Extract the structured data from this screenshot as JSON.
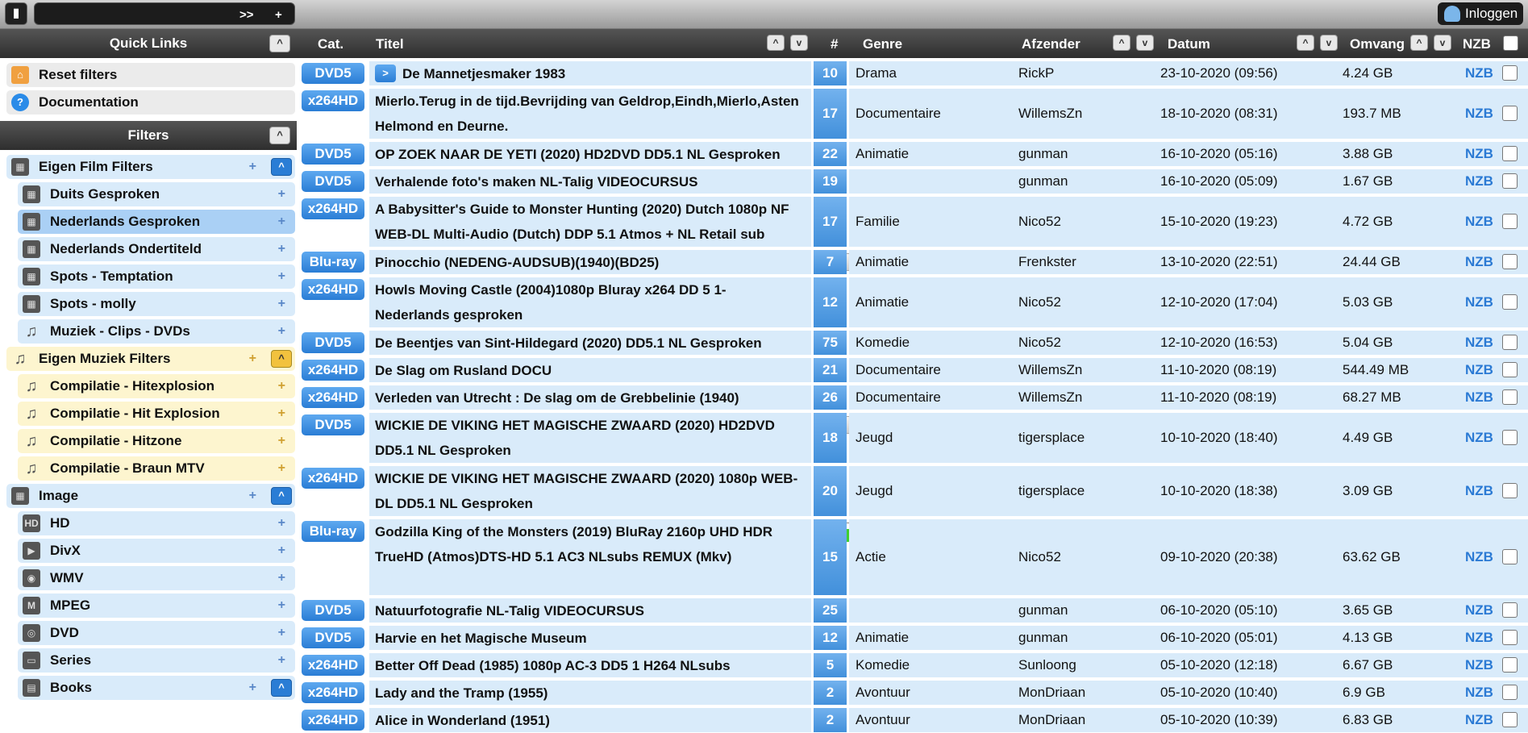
{
  "top": {
    "search_arrows": ">>",
    "search_plus": "+",
    "login": "Inloggen"
  },
  "left": {
    "quicklinks_title": "Quick Links",
    "quicklinks": [
      "Reset filters",
      "Documentation"
    ],
    "filters_title": "Filters",
    "items": [
      {
        "label": "Eigen Film Filters",
        "level": 0,
        "theme": "blue",
        "toggle": true
      },
      {
        "label": "Duits Gesproken",
        "level": 1,
        "theme": "blue"
      },
      {
        "label": "Nederlands Gesproken",
        "level": 1,
        "theme": "selected"
      },
      {
        "label": "Nederlands Ondertiteld",
        "level": 1,
        "theme": "blue"
      },
      {
        "label": "Spots - Temptation",
        "level": 1,
        "theme": "blue"
      },
      {
        "label": "Spots - molly",
        "level": 1,
        "theme": "blue"
      },
      {
        "label": "Muziek - Clips - DVDs",
        "level": 1,
        "theme": "blue"
      },
      {
        "label": "Eigen Muziek Filters",
        "level": 0,
        "theme": "yellow",
        "toggle": true
      },
      {
        "label": "Compilatie - Hitexplosion",
        "level": 1,
        "theme": "yellow"
      },
      {
        "label": "Compilatie - Hit Explosion",
        "level": 1,
        "theme": "yellow"
      },
      {
        "label": "Compilatie - Hitzone",
        "level": 1,
        "theme": "yellow"
      },
      {
        "label": "Compilatie - Braun MTV",
        "level": 1,
        "theme": "yellow"
      },
      {
        "label": "Image",
        "level": 0,
        "theme": "blue",
        "toggle": true
      },
      {
        "label": "HD",
        "level": 1,
        "theme": "blue"
      },
      {
        "label": "DivX",
        "level": 1,
        "theme": "blue"
      },
      {
        "label": "WMV",
        "level": 1,
        "theme": "blue"
      },
      {
        "label": "MPEG",
        "level": 1,
        "theme": "blue"
      },
      {
        "label": "DVD",
        "level": 1,
        "theme": "blue"
      },
      {
        "label": "Series",
        "level": 1,
        "theme": "blue"
      },
      {
        "label": "Books",
        "level": 1,
        "theme": "blue",
        "toggle": true
      }
    ]
  },
  "table": {
    "headers": {
      "cat": "Cat.",
      "title": "Titel",
      "num": "#",
      "genre": "Genre",
      "sender": "Afzender",
      "date": "Datum",
      "size": "Omvang",
      "nzb": "NZB"
    },
    "rows": [
      {
        "cat": "DVD5",
        "play": ">",
        "title": "De Mannetjesmaker 1983",
        "num": "10",
        "genre": "Drama",
        "sender": "RickP",
        "date": "23-10-2020 (09:56)",
        "size": "4.24 GB",
        "nzb": "NZB"
      },
      {
        "cat": "x264HD",
        "title": "Mierlo.Terug in de tijd.Bevrijding van Geldrop,Eindh,Mierlo,Asten Helmond en Deurne.",
        "num": "17",
        "genre": "Documentaire",
        "sender": "WillemsZn",
        "date": "18-10-2020 (08:31)",
        "size": "193.7 MB",
        "nzb": "NZB"
      },
      {
        "cat": "DVD5",
        "title": "OP ZOEK NAAR DE YETI (2020) HD2DVD DD5.1 NL Gesproken",
        "num": "22",
        "genre": "Animatie",
        "sender": "gunman",
        "date": "16-10-2020 (05:16)",
        "size": "3.88 GB",
        "nzb": "NZB"
      },
      {
        "cat": "DVD5",
        "title": "Verhalende foto's maken NL-Talig VIDEOCURSUS",
        "num": "19",
        "genre": "",
        "sender": "gunman",
        "date": "16-10-2020 (05:09)",
        "size": "1.67 GB",
        "nzb": "NZB"
      },
      {
        "cat": "x264HD",
        "title": "A Babysitter's Guide to Monster Hunting (2020) Dutch 1080p NF WEB-DL Multi-Audio (Dutch) DDP 5.1 Atmos + NL Retail sub",
        "num": "17",
        "genre": "Familie",
        "sender": "Nico52",
        "date": "15-10-2020 (19:23)",
        "size": "4.72 GB",
        "nzb": "NZB"
      },
      {
        "cat": "Blu-ray",
        "title": "Pinocchio (NEDENG-AUDSUB)(1940)(BD25)",
        "warn": "1",
        "num": "7",
        "genre": "Animatie",
        "sender": "Frenkster",
        "date": "13-10-2020 (22:51)",
        "size": "24.44 GB",
        "nzb": "NZB"
      },
      {
        "cat": "x264HD",
        "title": "Howls Moving Castle (2004)1080p Bluray x264 DD 5 1-Nederlands gesproken",
        "num": "12",
        "genre": "Animatie",
        "sender": "Nico52",
        "date": "12-10-2020 (17:04)",
        "size": "5.03 GB",
        "nzb": "NZB"
      },
      {
        "cat": "DVD5",
        "title": "De Beentjes van Sint-Hildegard (2020) DD5.1 NL Gesproken",
        "num": "75",
        "genre": "Komedie",
        "sender": "Nico52",
        "date": "12-10-2020 (16:53)",
        "size": "5.04 GB",
        "nzb": "NZB"
      },
      {
        "cat": "x264HD",
        "title": "De Slag om Rusland DOCU",
        "num": "21",
        "genre": "Documentaire",
        "sender": "WillemsZn",
        "date": "11-10-2020 (08:19)",
        "size": "544.49 MB",
        "nzb": "NZB"
      },
      {
        "cat": "x264HD",
        "title": "Verleden van Utrecht : De slag om de Grebbelinie (1940)",
        "num": "26",
        "genre": "Documentaire",
        "sender": "WillemsZn",
        "date": "11-10-2020 (08:19)",
        "size": "68.27 MB",
        "nzb": "NZB"
      },
      {
        "cat": "DVD5",
        "title": "WICKIE DE VIKING HET MAGISCHE ZWAARD (2020) HD2DVD DD5.1 NL Gesproken",
        "warn": "1",
        "num": "18",
        "genre": "Jeugd",
        "sender": "tigersplace",
        "date": "10-10-2020 (18:40)",
        "size": "4.49 GB",
        "nzb": "NZB"
      },
      {
        "cat": "x264HD",
        "title": "WICKIE DE VIKING HET MAGISCHE ZWAARD (2020) 1080p WEB-DL DD5.1 NL Gesproken",
        "num": "20",
        "genre": "Jeugd",
        "sender": "tigersplace",
        "date": "10-10-2020 (18:38)",
        "size": "3.09 GB",
        "nzb": "NZB"
      },
      {
        "cat": "Blu-ray",
        "title": "Godzilla King of the Monsters (2019) BluRay 2160p UHD HDR TrueHD (Atmos)DTS-HD 5.1 AC3 NLsubs REMUX (Mkv)",
        "rating": 1.0,
        "num": "15",
        "genre": "Actie",
        "sender": "Nico52",
        "date": "09-10-2020 (20:38)",
        "size": "63.62 GB",
        "nzb": "NZB"
      },
      {
        "cat": "DVD5",
        "title": "Natuurfotografie NL-Talig VIDEOCURSUS",
        "num": "25",
        "genre": "",
        "sender": "gunman",
        "date": "06-10-2020 (05:10)",
        "size": "3.65 GB",
        "nzb": "NZB"
      },
      {
        "cat": "DVD5",
        "title": "Harvie en het Magische Museum",
        "num": "12",
        "genre": "Animatie",
        "sender": "gunman",
        "date": "06-10-2020 (05:01)",
        "size": "4.13 GB",
        "nzb": "NZB"
      },
      {
        "cat": "x264HD",
        "title": "Better Off Dead (1985) 1080p AC-3 DD5 1 H264 NLsubs",
        "num": "5",
        "genre": "Komedie",
        "sender": "Sunloong",
        "date": "05-10-2020 (12:18)",
        "size": "6.67 GB",
        "nzb": "NZB"
      },
      {
        "cat": "x264HD",
        "title": "Lady and the Tramp (1955)",
        "num": "2",
        "genre": "Avontuur",
        "sender": "MonDriaan",
        "date": "05-10-2020 (10:40)",
        "size": "6.9 GB",
        "nzb": "NZB"
      },
      {
        "cat": "x264HD",
        "title": "Alice in Wonderland (1951)",
        "num": "2",
        "genre": "Avontuur",
        "sender": "MonDriaan",
        "date": "05-10-2020 (10:39)",
        "size": "6.83 GB",
        "nzb": "NZB"
      }
    ]
  }
}
